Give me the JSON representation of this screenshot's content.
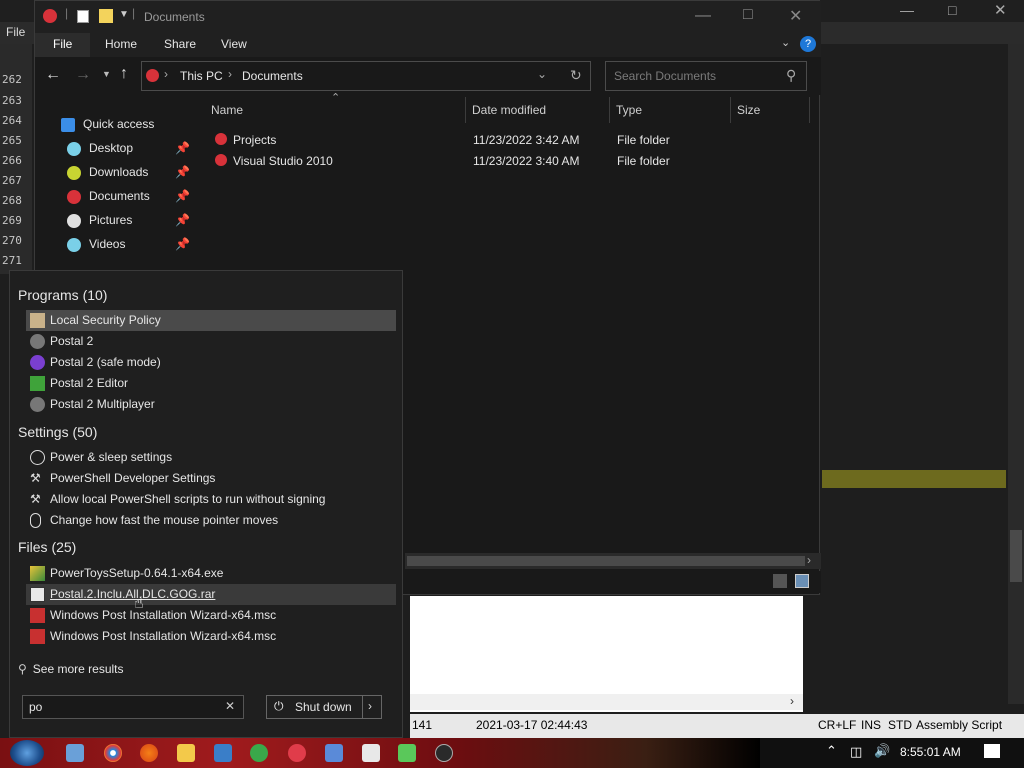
{
  "background_editor": {
    "menu_file": "File",
    "line_numbers": [
      "262",
      "263",
      "264",
      "265",
      "266",
      "267",
      "268",
      "269",
      "270",
      "271"
    ],
    "status": {
      "line": "141",
      "datetime": "2021-03-17 02:44:43",
      "eol": "CR+LF",
      "ins": "INS",
      "std": "STD",
      "language": "Assembly Script"
    }
  },
  "explorer": {
    "title": "Documents",
    "ribbon_tabs": [
      "File",
      "Home",
      "Share",
      "View"
    ],
    "breadcrumb": [
      "This PC",
      "Documents"
    ],
    "search_placeholder": "Search Documents",
    "nav_items": [
      {
        "label": "Quick access",
        "color": "#3b8ee8"
      },
      {
        "label": "Desktop",
        "color": "#7ad0e8"
      },
      {
        "label": "Downloads",
        "color": "#c8d432"
      },
      {
        "label": "Documents",
        "color": "#d8323a"
      },
      {
        "label": "Pictures",
        "color": "#e0e0e0"
      },
      {
        "label": "Videos",
        "color": "#7ad0e8"
      }
    ],
    "columns": [
      "Name",
      "Date modified",
      "Type",
      "Size"
    ],
    "files": [
      {
        "name": "Projects",
        "date": "11/23/2022 3:42 AM",
        "type": "File folder"
      },
      {
        "name": "Visual Studio 2010",
        "date": "11/23/2022 3:40 AM",
        "type": "File folder"
      }
    ]
  },
  "start_search": {
    "sections": [
      {
        "title": "Programs (10)",
        "items": [
          "Local Security Policy",
          "Postal 2",
          "Postal 2 (safe mode)",
          "Postal 2 Editor",
          "Postal 2 Multiplayer"
        ]
      },
      {
        "title": "Settings (50)",
        "items": [
          "Power & sleep settings",
          "PowerShell Developer Settings",
          "Allow local PowerShell scripts to run without signing",
          "Change how fast the mouse pointer moves"
        ]
      },
      {
        "title": "Files (25)",
        "items": [
          "PowerToysSetup-0.64.1-x64.exe",
          "Postal.2.Inclu.All.DLC.GOG.rar",
          "Windows Post Installation Wizard-x64.msc",
          "Windows Post Installation Wizard-x64.msc"
        ]
      }
    ],
    "see_more": "See more results",
    "query": "po",
    "shutdown_label": "Shut down"
  },
  "taskbar": {
    "clock": "8:55:01 AM",
    "accent": "#a01b1d"
  }
}
